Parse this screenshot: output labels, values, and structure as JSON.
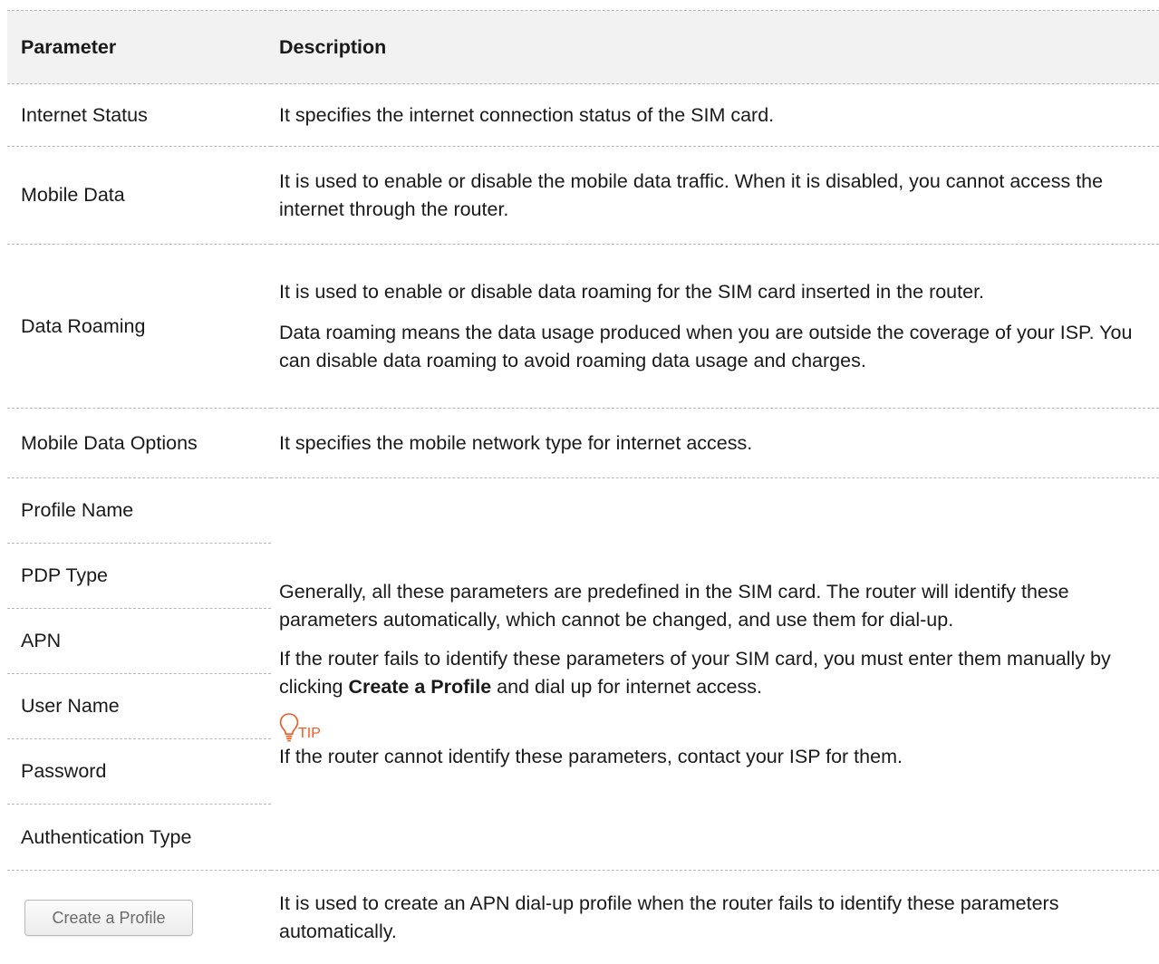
{
  "table": {
    "headers": {
      "parameter": "Parameter",
      "description": "Description"
    },
    "rows": [
      {
        "parameter": "Internet Status",
        "description": [
          "It specifies the internet connection status of the SIM card."
        ]
      },
      {
        "parameter": "Mobile Data",
        "description": [
          "It is used to enable or disable the mobile data traffic. When it is disabled, you cannot access the internet through the router."
        ]
      },
      {
        "parameter": "Data Roaming",
        "description": [
          "It is used to enable or disable data roaming for the SIM card inserted in the router.",
          "Data roaming means the data usage produced when you are outside the coverage of your ISP. You can disable data roaming to avoid roaming data usage and charges."
        ]
      },
      {
        "parameter": "Mobile Data Options",
        "description": [
          "It specifies the mobile network type for internet access."
        ]
      }
    ],
    "profile_group": {
      "parameters": [
        "Profile Name",
        "PDP Type",
        "APN",
        "User Name",
        "Password",
        "Authentication Type"
      ],
      "description_p1": "Generally, all these parameters are predefined in the SIM card. The router will identify these parameters automatically, which cannot be changed, and use them for dial-up.",
      "description_p2_before": "If the router fails to identify these parameters of your SIM card, you must enter them manually by clicking ",
      "description_p2_bold": "Create a Profile",
      "description_p2_after": " and dial up for internet access.",
      "tip_label": "TIP",
      "tip_text": "If the router cannot identify these parameters, contact your ISP for them."
    },
    "button_row": {
      "button_label": "Create a Profile",
      "description": "It is used to create an APN dial-up profile when the router fails to identify these parameters automatically."
    }
  },
  "colors": {
    "header_bg": "#f2f2f2",
    "tip_accent": "#f05a22",
    "divider": "#b7b7b7"
  }
}
